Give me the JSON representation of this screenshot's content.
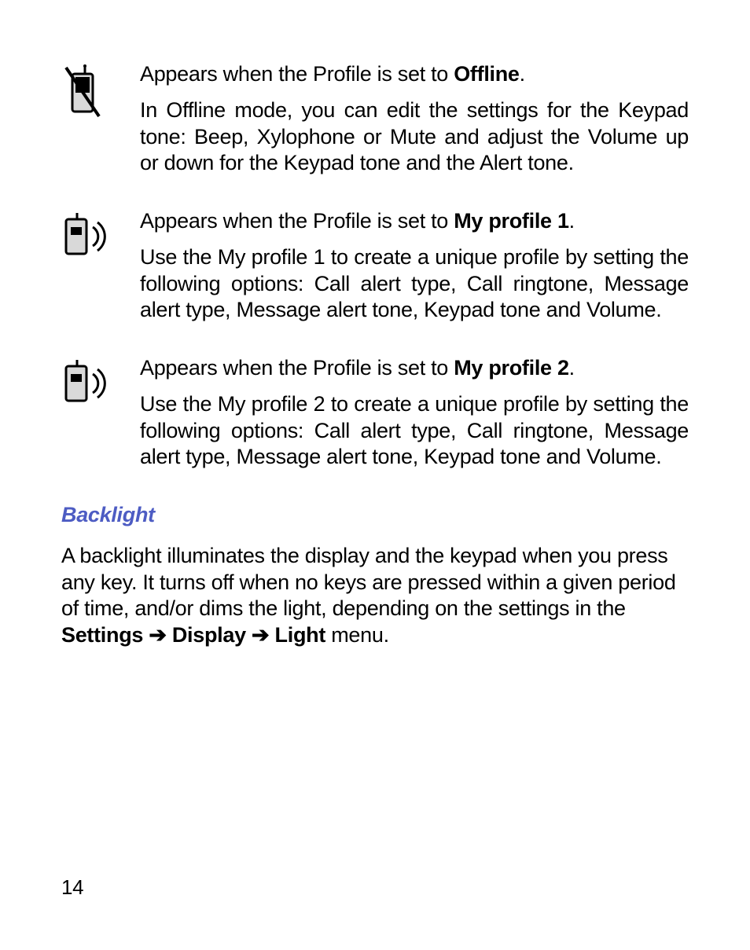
{
  "rows": [
    {
      "icon": "offline-phone-icon",
      "lead_pre": "Appears when the Profile is set to ",
      "lead_bold": "Offline",
      "lead_post": ".",
      "desc": "In Offline mode, you can edit the settings for the Keypad tone: Beep, Xylophone or Mute and adjust the Volume up or down for the Keypad tone and the Alert tone."
    },
    {
      "icon": "my-profile-1-icon",
      "lead_pre": "Appears when the Profile is set to ",
      "lead_bold": "My profile 1",
      "lead_post": ".",
      "desc": "Use the My profile 1 to create a unique profile by setting the following options: Call alert type, Call ringtone, Message alert type, Message alert tone, Keypad tone and Volume."
    },
    {
      "icon": "my-profile-2-icon",
      "lead_pre": "Appears when the Profile is set to ",
      "lead_bold": "My profile 2",
      "lead_post": ".",
      "desc": "Use the My profile 2 to create a unique profile by setting the following options: Call alert type, Call ringtone, Message alert type, Message alert tone, Keypad tone and Volume."
    }
  ],
  "section": {
    "title": "Backlight",
    "para_pre": "A backlight illuminates the display and the keypad when you press any key. It turns off when no keys are pressed within a given period of time, and/or dims the light, depending on the settings in the ",
    "b1": "Settings",
    "arrow1": " ➔ ",
    "b2": "Display",
    "arrow2": " ➔ ",
    "b3": "Light",
    "para_post": " menu."
  },
  "page_number": "14"
}
